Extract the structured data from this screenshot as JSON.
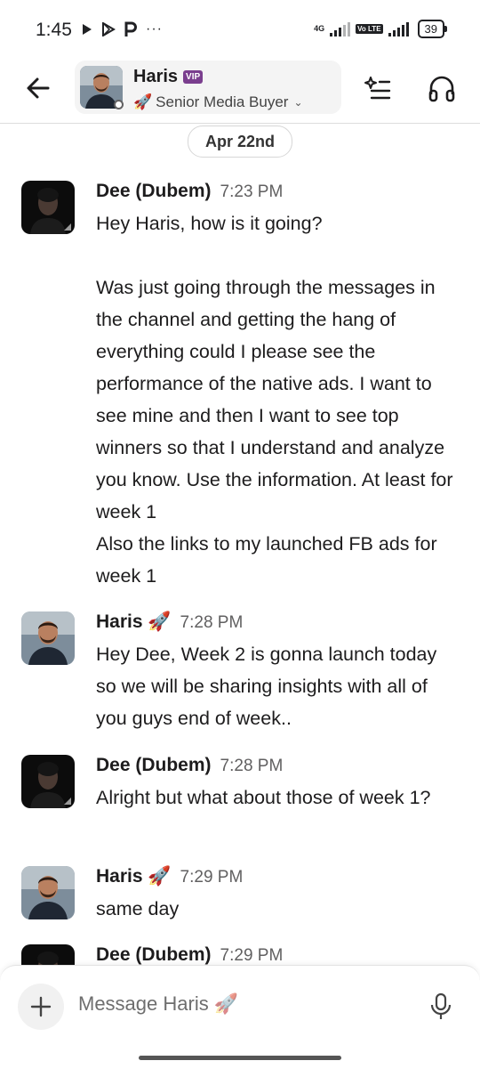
{
  "status_bar": {
    "time": "1:45",
    "left_icons": [
      "play-store-icon",
      "play-triangle-icon",
      "p-icon",
      "more-dots-icon"
    ],
    "network_label": "4G",
    "volte_label": "Vo LTE",
    "battery": "39"
  },
  "header": {
    "back_icon": "arrow-left-icon",
    "contact_name": "Haris",
    "badge": "VIP",
    "status_emoji": "🚀",
    "status_text": "Senior Media Buyer",
    "chevron": "⌄",
    "summary_icon": "ai-summary-icon",
    "huddle_icon": "headphones-icon"
  },
  "date_divider": "Apr 22nd",
  "messages": [
    {
      "author": "Dee (Dubem)",
      "time": "7:23 PM",
      "paragraphs": [
        "Hey Haris, how is it going?",
        "Was just going through the messages in the channel and getting the hang of everything could I please see the performance of the native ads. I want to see mine and then I want to see top winners so that I understand and analyze you know. Use the information. At least for week 1\nAlso the links to my launched FB ads for week 1"
      ]
    },
    {
      "author": "Haris",
      "author_emoji": "🚀",
      "time": "7:28 PM",
      "paragraphs": [
        "Hey Dee, Week 2 is gonna launch today so we will be sharing insights with all of you guys end of week.."
      ]
    },
    {
      "author": "Dee (Dubem)",
      "time": "7:28 PM",
      "paragraphs": [
        "Alright but what about those of week 1?"
      ]
    },
    {
      "author": "Haris",
      "author_emoji": "🚀",
      "time": "7:29 PM",
      "paragraphs": [
        "same day"
      ]
    },
    {
      "author": "Dee (Dubem)",
      "time": "7:29 PM",
      "paragraphs": []
    }
  ],
  "composer": {
    "placeholder": "Message Haris",
    "placeholder_emoji": "🚀",
    "add_icon": "plus-icon",
    "mic_icon": "microphone-icon"
  },
  "colors": {
    "vip_badge": "#7a3e8e",
    "text": "#1d1c1d",
    "muted": "#616061",
    "chip_bg": "#f4f4f4"
  }
}
